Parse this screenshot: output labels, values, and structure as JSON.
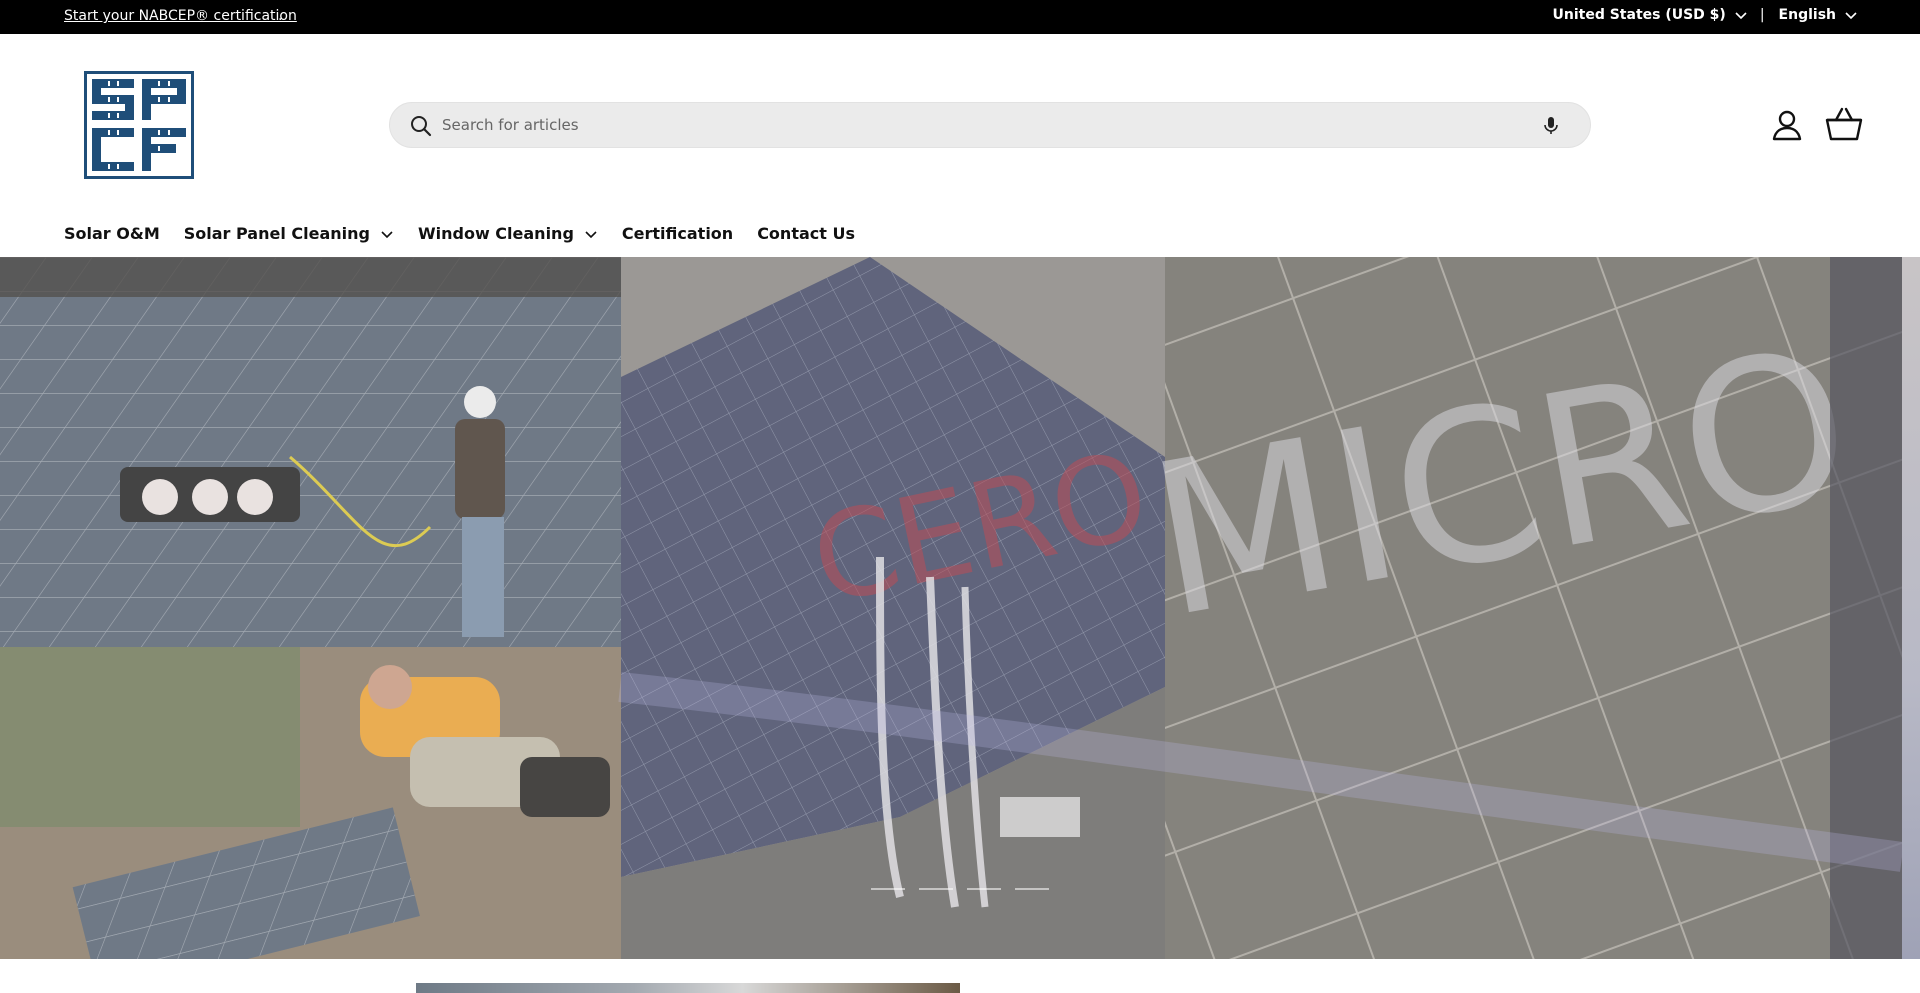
{
  "announcement": {
    "promo_link": "Start your NABCEP® certification",
    "promo_suffix": ".",
    "country_selector": "United States (USD $)",
    "separator": "|",
    "language_selector": "English"
  },
  "header": {
    "logo_text": "SPCF",
    "search_placeholder": "Search for articles"
  },
  "nav": {
    "items": [
      {
        "label": "Solar O&M",
        "has_dropdown": false
      },
      {
        "label": "Solar Panel Cleaning",
        "has_dropdown": true
      },
      {
        "label": "Window Cleaning",
        "has_dropdown": true
      },
      {
        "label": "Certification",
        "has_dropdown": false
      },
      {
        "label": "Contact Us",
        "has_dropdown": false
      }
    ]
  },
  "hero": {
    "slide_count": 4,
    "watermark_text": "CEERO MICRO"
  },
  "colors": {
    "logo_blue": "#1f4e79",
    "topbar_bg": "#000000",
    "search_bg": "#ebebeb"
  }
}
